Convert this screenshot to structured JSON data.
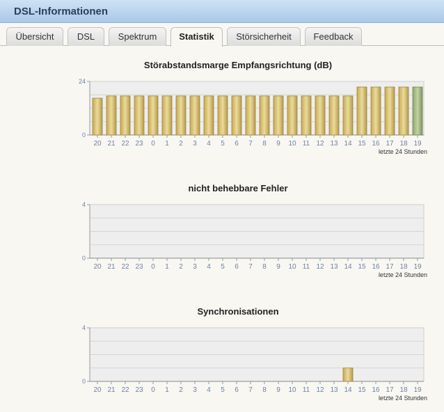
{
  "header": {
    "title": "DSL-Informationen"
  },
  "tabs": [
    {
      "label": "Übersicht",
      "active": false
    },
    {
      "label": "DSL",
      "active": false
    },
    {
      "label": "Spektrum",
      "active": false
    },
    {
      "label": "Statistik",
      "active": true
    },
    {
      "label": "Störsicherheit",
      "active": false
    },
    {
      "label": "Feedback",
      "active": false
    }
  ],
  "colors": {
    "bar_fill": "#d7c17a",
    "bar_current_fill": "#a7b98a",
    "plot_bg": "#eeeeee",
    "grid": "#d4d4d4",
    "tick_label": "#6b82a8"
  },
  "chart_data": [
    {
      "type": "bar",
      "title": "Störabstandsmarge Empfangsrichtung (dB)",
      "xlabel": "letzte 24 Stunden",
      "ylabel": "",
      "ylim": [
        0,
        24
      ],
      "yticks": [
        0,
        24
      ],
      "categories": [
        "20",
        "21",
        "22",
        "23",
        "0",
        "1",
        "2",
        "3",
        "4",
        "5",
        "6",
        "7",
        "8",
        "9",
        "10",
        "11",
        "12",
        "13",
        "14",
        "15",
        "16",
        "17",
        "18",
        "19"
      ],
      "values": [
        16.5,
        17.5,
        17.5,
        17.5,
        17.5,
        17.5,
        17.5,
        17.5,
        17.5,
        17.5,
        17.5,
        17.5,
        17.5,
        17.5,
        17.5,
        17.5,
        17.5,
        17.5,
        17.5,
        21.5,
        21.5,
        21.5,
        21.5,
        21.5
      ],
      "highlight_last": true,
      "grid": true
    },
    {
      "type": "bar",
      "title": "nicht behebbare Fehler",
      "xlabel": "letzte 24 Stunden",
      "ylabel": "",
      "ylim": [
        0,
        4
      ],
      "yticks": [
        0,
        4
      ],
      "categories": [
        "20",
        "21",
        "22",
        "23",
        "0",
        "1",
        "2",
        "3",
        "4",
        "5",
        "6",
        "7",
        "8",
        "9",
        "10",
        "11",
        "12",
        "13",
        "14",
        "15",
        "16",
        "17",
        "18",
        "19"
      ],
      "values": [
        0,
        0,
        0,
        0,
        0,
        0,
        0,
        0,
        0,
        0,
        0,
        0,
        0,
        0,
        0,
        0,
        0,
        0,
        0,
        0,
        0,
        0,
        0,
        0
      ],
      "highlight_last": false,
      "grid": true
    },
    {
      "type": "bar",
      "title": "Synchronisationen",
      "xlabel": "letzte 24 Stunden",
      "ylabel": "",
      "ylim": [
        0,
        4
      ],
      "yticks": [
        0,
        4
      ],
      "categories": [
        "20",
        "21",
        "22",
        "23",
        "0",
        "1",
        "2",
        "3",
        "4",
        "5",
        "6",
        "7",
        "8",
        "9",
        "10",
        "11",
        "12",
        "13",
        "14",
        "15",
        "16",
        "17",
        "18",
        "19"
      ],
      "values": [
        0,
        0,
        0,
        0,
        0,
        0,
        0,
        0,
        0,
        0,
        0,
        0,
        0,
        0,
        0,
        0,
        0,
        0,
        1,
        0,
        0,
        0,
        0,
        0
      ],
      "highlight_last": false,
      "grid": true
    }
  ]
}
